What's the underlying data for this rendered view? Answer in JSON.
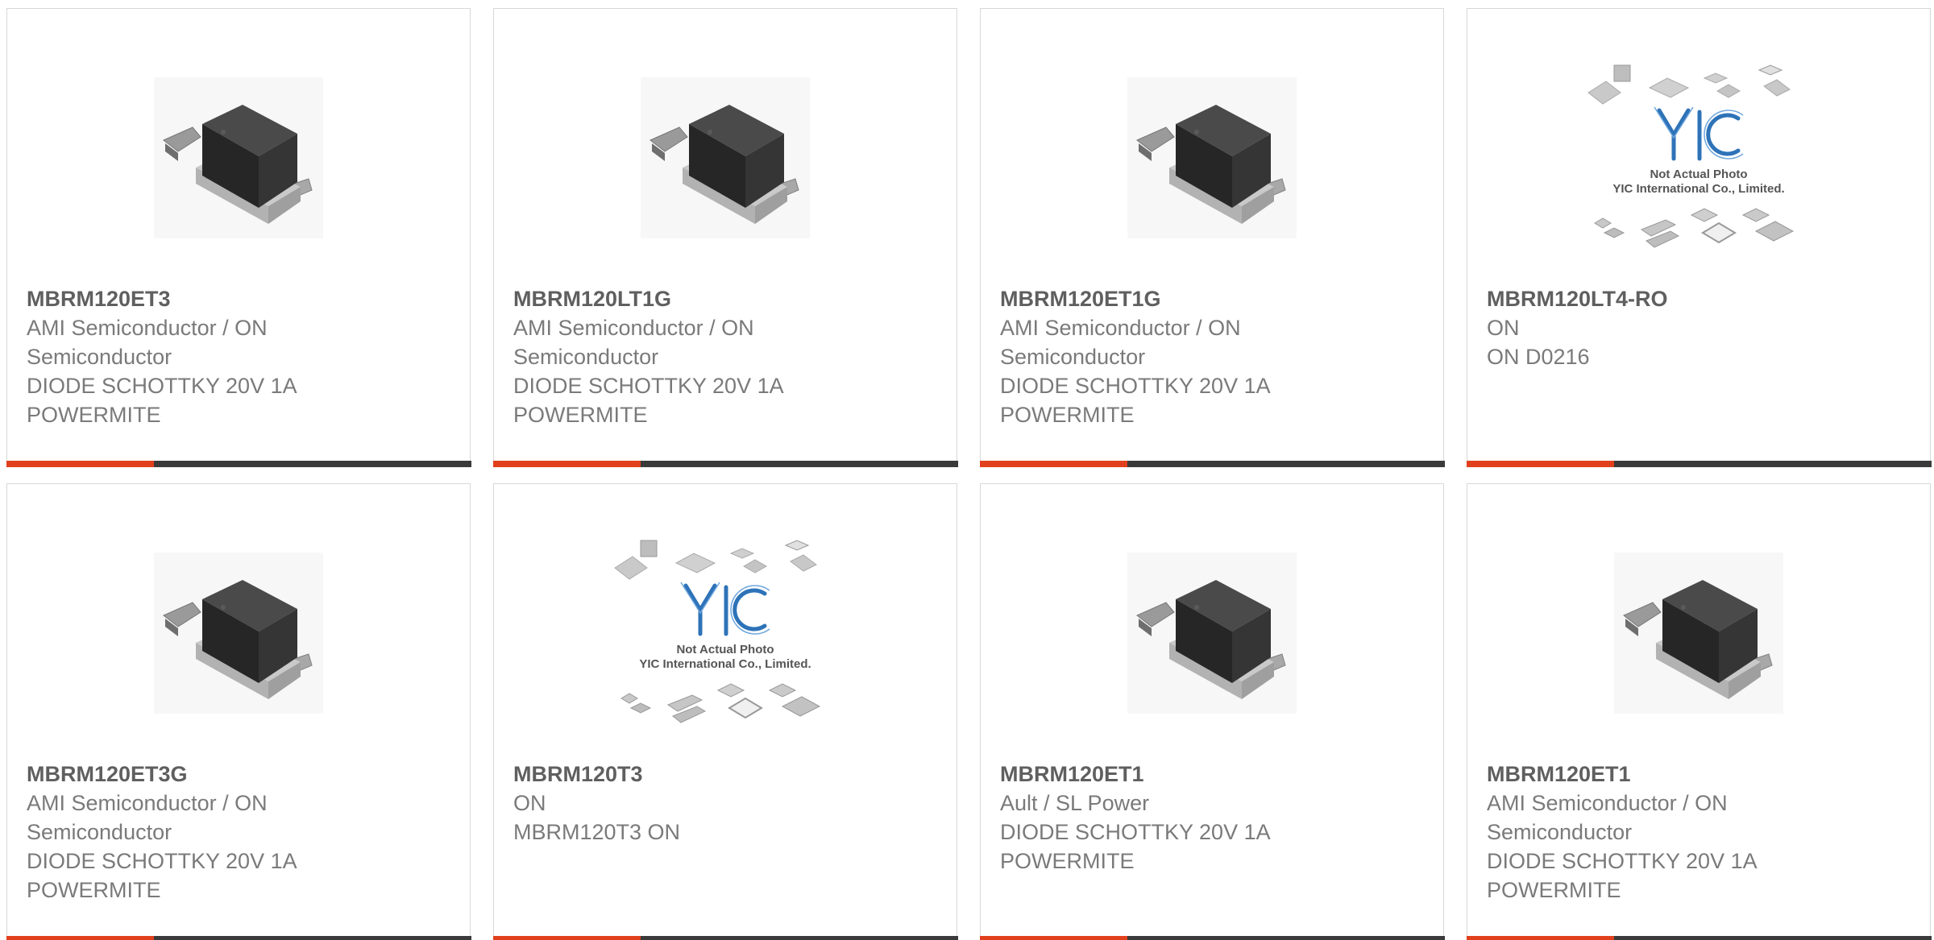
{
  "colors": {
    "accent": "#e1401d",
    "bar": "#3a3a3a",
    "text": "#7a7a7a",
    "title": "#5f5f5f",
    "border": "#d8d8d8"
  },
  "products": [
    {
      "part_number": "MBRM120ET3",
      "manufacturer": "AMI Semiconductor / ON Semiconductor",
      "description": "DIODE SCHOTTKY 20V 1A POWERMITE",
      "image": "powermite-diode-photo"
    },
    {
      "part_number": "MBRM120LT1G",
      "manufacturer": "AMI Semiconductor / ON Semiconductor",
      "description": "DIODE SCHOTTKY 20V 1A POWERMITE",
      "image": "powermite-diode-photo"
    },
    {
      "part_number": "MBRM120ET1G",
      "manufacturer": "AMI Semiconductor / ON Semiconductor",
      "description": "DIODE SCHOTTKY 20V 1A POWERMITE",
      "image": "powermite-diode-photo"
    },
    {
      "part_number": "MBRM120LT4-RO",
      "manufacturer": "ON",
      "description": "ON D0216",
      "image": "not-actual-photo-placeholder",
      "placeholder_line1": "Not Actual Photo",
      "placeholder_line2": "YIC International Co., Limited."
    },
    {
      "part_number": "MBRM120ET3G",
      "manufacturer": "AMI Semiconductor / ON Semiconductor",
      "description": "DIODE SCHOTTKY 20V 1A POWERMITE",
      "image": "powermite-diode-photo"
    },
    {
      "part_number": "MBRM120T3",
      "manufacturer": "ON",
      "description": "MBRM120T3 ON",
      "image": "not-actual-photo-placeholder",
      "placeholder_line1": "Not Actual Photo",
      "placeholder_line2": "YIC International Co., Limited."
    },
    {
      "part_number": "MBRM120ET1",
      "manufacturer": "Ault / SL Power",
      "description": "DIODE SCHOTTKY 20V 1A POWERMITE",
      "image": "powermite-diode-photo"
    },
    {
      "part_number": "MBRM120ET1",
      "manufacturer": "AMI Semiconductor / ON Semiconductor",
      "description": "DIODE SCHOTTKY 20V 1A POWERMITE",
      "image": "powermite-diode-photo"
    }
  ]
}
